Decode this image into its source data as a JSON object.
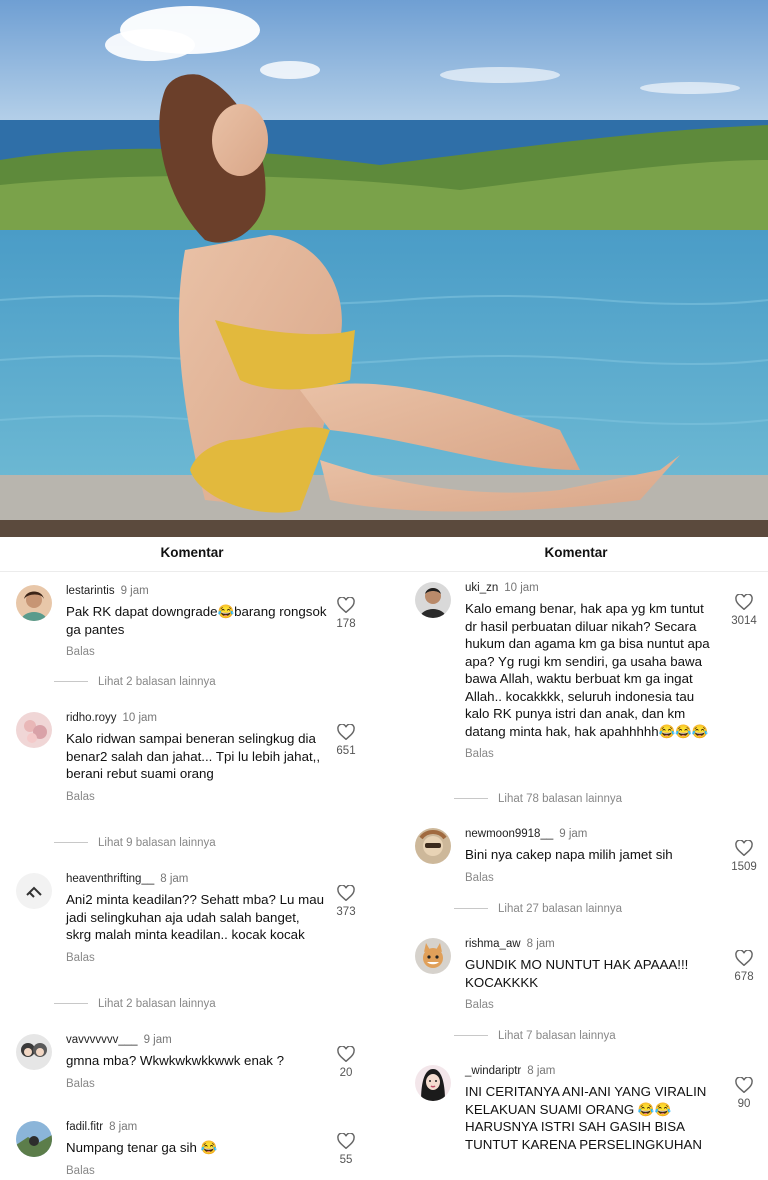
{
  "left_panel": {
    "title": "Komentar",
    "comments": [
      {
        "username": "lestarintis",
        "time": "9 jam",
        "text": "Pak RK dapat downgrade😂barang rongsok ga pantes",
        "reply": "Balas",
        "likes": "178",
        "more": "Lihat 2 balasan lainnya"
      },
      {
        "username": "ridho.royy",
        "time": "10 jam",
        "text": "Kalo ridwan sampai beneran selingkug dia benar2 salah dan jahat... Tpi lu lebih jahat,, berani rebut suami orang",
        "reply": "Balas",
        "likes": "651",
        "more": "Lihat 9 balasan lainnya"
      },
      {
        "username": "heaventhrifting__",
        "time": "8 jam",
        "text": "Ani2 minta keadilan?? Sehatt mba? Lu mau jadi selingkuhan aja udah salah banget, skrg malah minta keadilan.. kocak kocak",
        "reply": "Balas",
        "likes": "373",
        "more": "Lihat 2 balasan lainnya"
      },
      {
        "username": "vavvvvvvv___",
        "time": "9 jam",
        "text": "gmna mba? Wkwkwkwkkwwk enak ?",
        "reply": "Balas",
        "likes": "20",
        "more": ""
      },
      {
        "username": "fadil.fitr",
        "time": "8 jam",
        "text": "Numpang tenar ga sih 😂",
        "reply": "Balas",
        "likes": "55",
        "more": ""
      }
    ]
  },
  "right_panel": {
    "title": "Komentar",
    "comments": [
      {
        "username": "uki_zn",
        "time": "10 jam",
        "text": "Kalo emang benar, hak apa yg km tuntut dr hasil perbuatan diluar nikah? Secara hukum dan agama km ga bisa nuntut apa apa? Yg rugi km sendiri, ga usaha bawa bawa Allah, waktu berbuat km ga ingat Allah.. kocakkkk, seluruh indonesia tau kalo RK punya istri dan anak, dan km datang minta hak, hak apahhhhh😂😂😂",
        "reply": "Balas",
        "likes": "3014",
        "more": "Lihat 78 balasan lainnya"
      },
      {
        "username": "newmoon9918__",
        "time": "9 jam",
        "text": "Bini nya cakep napa milih jamet sih",
        "reply": "Balas",
        "likes": "1509",
        "more": "Lihat 27 balasan lainnya"
      },
      {
        "username": "rishma_aw",
        "time": "8 jam",
        "text": "GUNDIK MO NUNTUT HAK APAAA!!! KOCAKKKK",
        "reply": "Balas",
        "likes": "678",
        "more": "Lihat 7 balasan lainnya"
      },
      {
        "username": "_windariptr",
        "time": "8 jam",
        "text": "INI CERITANYA ANI-ANI  YANG VIRALIN KELAKUAN SUAMI ORANG 😂😂HARUSNYA ISTRI SAH GASIH BISA TUNTUT KARENA PERSELINGKUHAN",
        "reply": "",
        "likes": "90",
        "more": ""
      }
    ]
  }
}
